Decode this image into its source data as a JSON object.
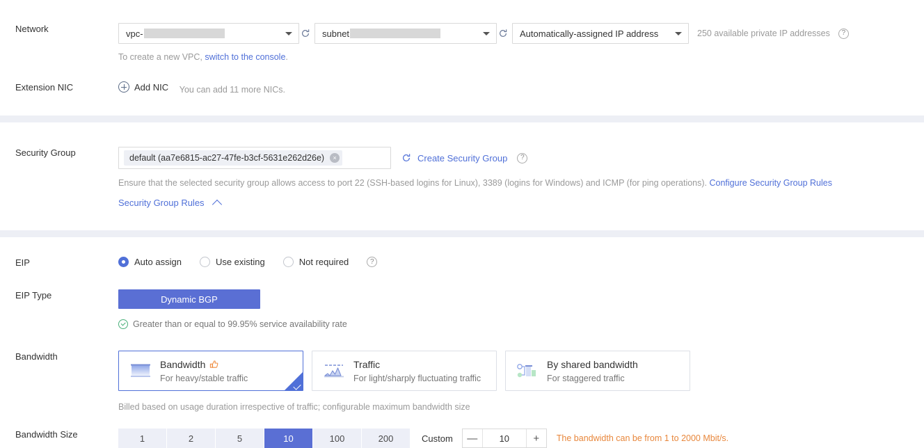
{
  "network": {
    "label": "Network",
    "vpc_value": "vpc-",
    "subnet_value": "subnet",
    "ip_value": "Automatically-assigned IP address",
    "available_ips": "250 available private IP addresses",
    "help_icon": "?",
    "refresh_icon": "refresh-icon",
    "hint_prefix": "To create a new VPC, ",
    "hint_link": "switch to the console",
    "hint_suffix": "."
  },
  "extension_nic": {
    "label": "Extension NIC",
    "add_label": "Add NIC",
    "hint": "You can add 11 more NICs."
  },
  "security_group": {
    "label": "Security Group",
    "tag_value": "default (aa7e6815-ac27-47fe-b3cf-5631e262d26e)",
    "tag_close": "×",
    "create_link": "Create Security Group",
    "help_icon": "?",
    "ensure_text": "Ensure that the selected security group allows access to port 22 (SSH-based logins for Linux), 3389 (logins for Windows) and ICMP (for ping operations). ",
    "configure_link": "Configure Security Group Rules",
    "rules_toggle": "Security Group Rules"
  },
  "eip": {
    "label": "EIP",
    "options": [
      {
        "label": "Auto assign",
        "selected": true
      },
      {
        "label": "Use existing",
        "selected": false
      },
      {
        "label": "Not required",
        "selected": false
      }
    ],
    "help_icon": "?"
  },
  "eip_type": {
    "label": "EIP Type",
    "selected_button": "Dynamic BGP",
    "availability_text": "Greater than or equal to 99.95% service availability rate"
  },
  "bandwidth": {
    "label": "Bandwidth",
    "cards": [
      {
        "title": "Bandwidth",
        "subtitle": "For heavy/stable traffic",
        "selected": true,
        "icon": "bandwidth-block-icon",
        "badge": "thumbs-up-icon"
      },
      {
        "title": "Traffic",
        "subtitle": "For light/sharply fluctuating traffic",
        "selected": false,
        "icon": "traffic-chart-icon",
        "badge": ""
      },
      {
        "title": "By shared bandwidth",
        "subtitle": "For staggered traffic",
        "selected": false,
        "icon": "shared-bandwidth-icon",
        "badge": ""
      }
    ],
    "note": "Billed based on usage duration irrespective of traffic; configurable maximum bandwidth size"
  },
  "bandwidth_size": {
    "label": "Bandwidth Size",
    "options": [
      "1",
      "2",
      "5",
      "10",
      "100",
      "200"
    ],
    "selected": "10",
    "custom_label": "Custom",
    "stepper_minus": "—",
    "stepper_value": "10",
    "stepper_plus": "+",
    "warning": "The bandwidth can be from 1 to 2000 Mbit/s."
  },
  "colors": {
    "accent": "#5070d8",
    "accent_fill": "#5a6fd4",
    "warning": "#e8873c",
    "success": "#4bb07a",
    "divider": "#edeff5",
    "muted": "#9a9a9a"
  }
}
